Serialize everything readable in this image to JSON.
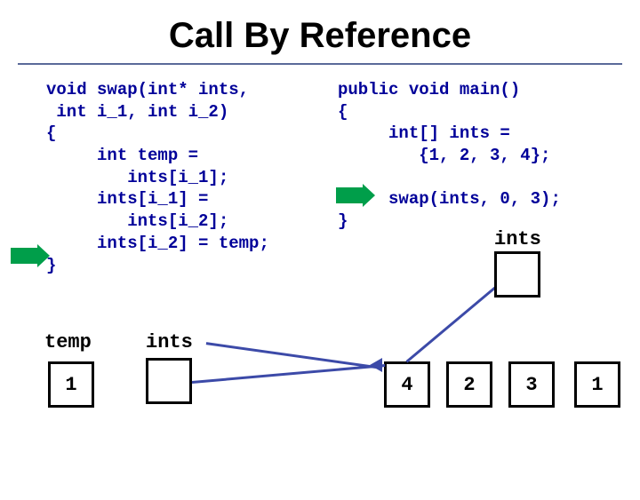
{
  "title": "Call By Reference",
  "code_left": "void swap(int* ints,\n int i_1, int i_2)\n{\n     int temp =\n        ints[i_1];\n     ints[i_1] =\n        ints[i_2];\n     ints[i_2] = temp;\n}",
  "code_right": "public void main()\n{\n     int[] ints =\n        {1, 2, 3, 4};\n\n     swap(ints, 0, 3);\n}",
  "labels": {
    "temp": "temp",
    "ints_left": "ints",
    "ints_right": "ints"
  },
  "boxes": {
    "temp": "1",
    "ints_empty": "",
    "arr0": "4",
    "arr1": "2",
    "arr2": "3",
    "arr3": "1"
  }
}
